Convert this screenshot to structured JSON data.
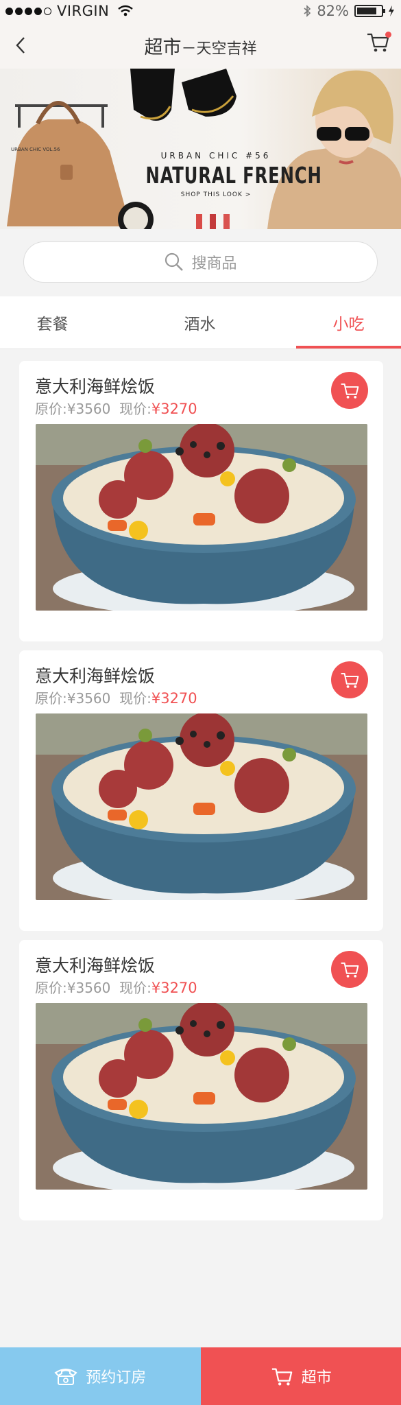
{
  "status_bar": {
    "carrier": "VIRGIN",
    "battery_percent": "82%",
    "battery_level": 0.82
  },
  "nav": {
    "title": "超市",
    "subtitle": "－天空吉祥"
  },
  "banner": {
    "sub": "URBAN CHIC #56",
    "main": "NATURAL FRENCH",
    "cta": "SHOP THIS LOOK >",
    "vol": "URBAN CHIC VOL.56"
  },
  "search": {
    "placeholder": "搜商品"
  },
  "tabs": [
    {
      "label": "套餐",
      "active": false
    },
    {
      "label": "酒水",
      "active": false
    },
    {
      "label": "小吃",
      "active": true
    }
  ],
  "products": [
    {
      "name": "意大利海鲜烩饭",
      "original_label": "原价:",
      "original_price": "¥3560",
      "current_label": "现价:",
      "current_price": "¥3270"
    },
    {
      "name": "意大利海鲜烩饭",
      "original_label": "原价:",
      "original_price": "¥3560",
      "current_label": "现价:",
      "current_price": "¥3270"
    },
    {
      "name": "意大利海鲜烩饭",
      "original_label": "原价:",
      "original_price": "¥3560",
      "current_label": "现价:",
      "current_price": "¥3270"
    }
  ],
  "bottom_bar": {
    "book_label": "预约订房",
    "market_label": "超市"
  },
  "colors": {
    "accent": "#f05153",
    "blue": "#86c9ee"
  }
}
